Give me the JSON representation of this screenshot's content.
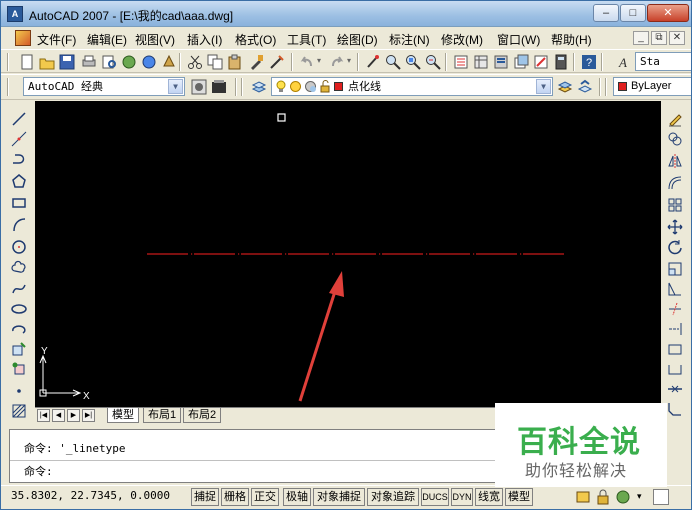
{
  "window": {
    "title": "AutoCAD 2007 - [E:\\我的cad\\aaa.dwg]",
    "minimize": "–",
    "maximize": "□",
    "close": "✕"
  },
  "menu": [
    "文件(F)",
    "编辑(E)",
    "视图(V)",
    "插入(I)",
    "格式(O)",
    "工具(T)",
    "绘图(D)",
    "标注(N)",
    "修改(M)",
    "窗口(W)",
    "帮助(H)"
  ],
  "mdi": {
    "minimize": "_",
    "restore": "⧉",
    "close": "✕"
  },
  "toolbar": {
    "style_text": "Sta"
  },
  "workspace": {
    "value": "AutoCAD 经典"
  },
  "layer": {
    "value": "点化线",
    "color": "#e02020"
  },
  "color_combo": {
    "value": "ByLayer",
    "color": "#e02020"
  },
  "drawing": {
    "background": "#000000",
    "line_color": "#c81a1a",
    "arrow_color": "#e0403a",
    "ucs": {
      "x_label": "X",
      "y_label": "Y"
    }
  },
  "tabs": {
    "model": "模型",
    "layout1": "布局1",
    "layout2": "布局2"
  },
  "command": {
    "line1": "命令: '_linetype",
    "line2": "命令:"
  },
  "status": {
    "coords": "35.8302, 22.7345, 0.0000",
    "buttons": [
      "捕捉",
      "栅格",
      "正交",
      "极轴",
      "对象捕捉",
      "对象追踪",
      "DUCS",
      "DYN",
      "线宽",
      "模型"
    ]
  },
  "watermark": {
    "title": "百科全说",
    "subtitle": "助你轻松解决"
  }
}
